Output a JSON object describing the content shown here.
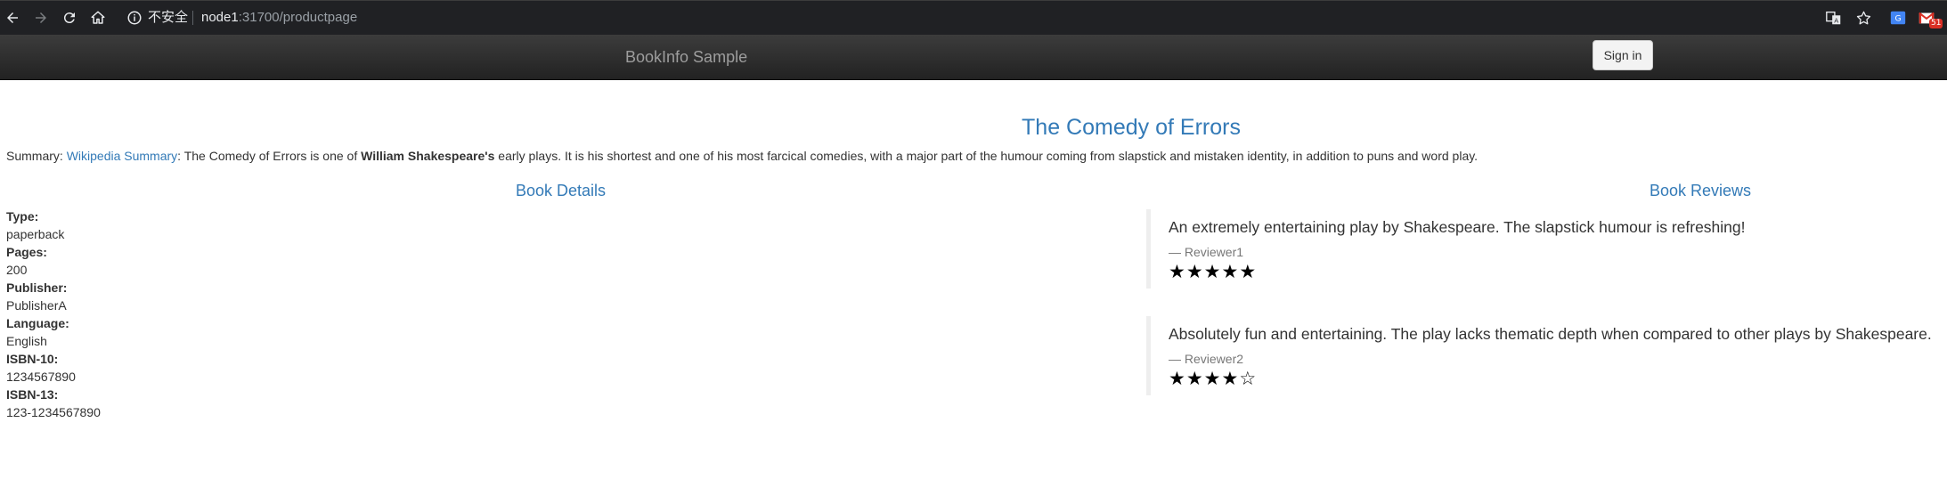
{
  "browser": {
    "security_text": "不安全",
    "url_host": "node1",
    "url_rest": ":31700/productpage",
    "extension_badge": "51",
    "icons": [
      "back-icon",
      "forward-icon",
      "reload-icon",
      "home-icon",
      "info-icon",
      "translate-icon",
      "star-icon",
      "extension-translate-icon",
      "gmail-icon"
    ]
  },
  "navbar": {
    "brand": "BookInfo Sample",
    "signin_label": "Sign in"
  },
  "product": {
    "title": "The Comedy of Errors",
    "summary_prefix": "Summary: ",
    "summary_link": "Wikipedia Summary",
    "summary_mid": ": The Comedy of Errors is one of ",
    "summary_bold": "William Shakespeare's",
    "summary_suffix": " early plays. It is his shortest and one of his most farcical comedies, with a major part of the humour coming from slapstick and mistaken identity, in addition to puns and word play."
  },
  "details": {
    "heading": "Book Details",
    "type_label": "Type:",
    "type_value": "paperback",
    "pages_label": "Pages:",
    "pages_value": "200",
    "publisher_label": "Publisher:",
    "publisher_value": "PublisherA",
    "language_label": "Language:",
    "language_value": "English",
    "isbn10_label": "ISBN-10:",
    "isbn10_value": "1234567890",
    "isbn13_label": "ISBN-13:",
    "isbn13_value": "123-1234567890"
  },
  "reviews": {
    "heading": "Book Reviews",
    "items": [
      {
        "text": "An extremely entertaining play by Shakespeare. The slapstick humour is refreshing!",
        "reviewer": "— Reviewer1",
        "rating": 5,
        "max_rating": 5
      },
      {
        "text": "Absolutely fun and entertaining. The play lacks thematic depth when compared to other plays by Shakespeare.",
        "reviewer": "— Reviewer2",
        "rating": 4,
        "max_rating": 5
      }
    ]
  },
  "colors": {
    "link": "#337ab7",
    "navbar_top": "#3c3c3c",
    "navbar_bottom": "#222222",
    "chrome_bg": "#202124"
  }
}
